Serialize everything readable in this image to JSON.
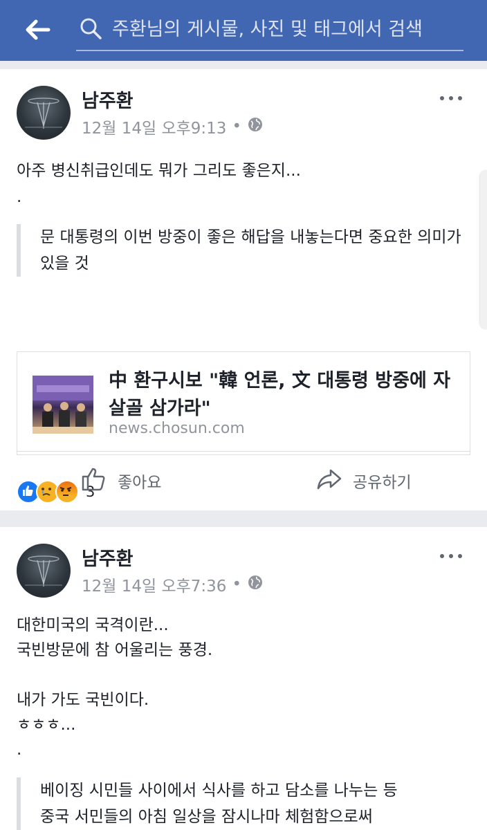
{
  "colors": {
    "header": "#4267b2",
    "like": "#1877f2",
    "sad": "#f7b125",
    "angry": "#e9710f",
    "secondary_text": "#90949c"
  },
  "search": {
    "placeholder": "주환님의 게시물, 사진 및 태그에서 검색"
  },
  "posts": [
    {
      "author": "남주환",
      "timestamp": "12월 14일 오후9:13",
      "separator": "•",
      "audience_icon": "globe-icon",
      "text": "아주 병신취급인데도 뭐가 그리도 좋은지...\n.",
      "quote": "문 대통령의 이번 방중이 좋은 해답을 내놓는다면 중요한 의미가 있을 것",
      "link": {
        "title": "中 환구시보 \"韓 언론, 文 대통령 방중에 자살골 삼가라\"",
        "domain": "news.chosun.com"
      },
      "reactions": {
        "icons": [
          "like-icon",
          "sad-icon",
          "angry-icon"
        ],
        "count": "3"
      },
      "actions": {
        "like": "좋아요",
        "share": "공유하기"
      }
    },
    {
      "author": "남주환",
      "timestamp": "12월 14일 오후7:36",
      "separator": "•",
      "audience_icon": "globe-icon",
      "text": "대한미국의 국격이란...\n국빈방문에 참 어울리는 풍경.\n\n내가 가도 국빈이다.\nㅎㅎㅎ...\n.",
      "quote": "베이징 시민들 사이에서 식사를 하고 담소를 나누는 등\n중국 서민들의 아침 일상을 잠시나마 체험함으로써"
    }
  ]
}
